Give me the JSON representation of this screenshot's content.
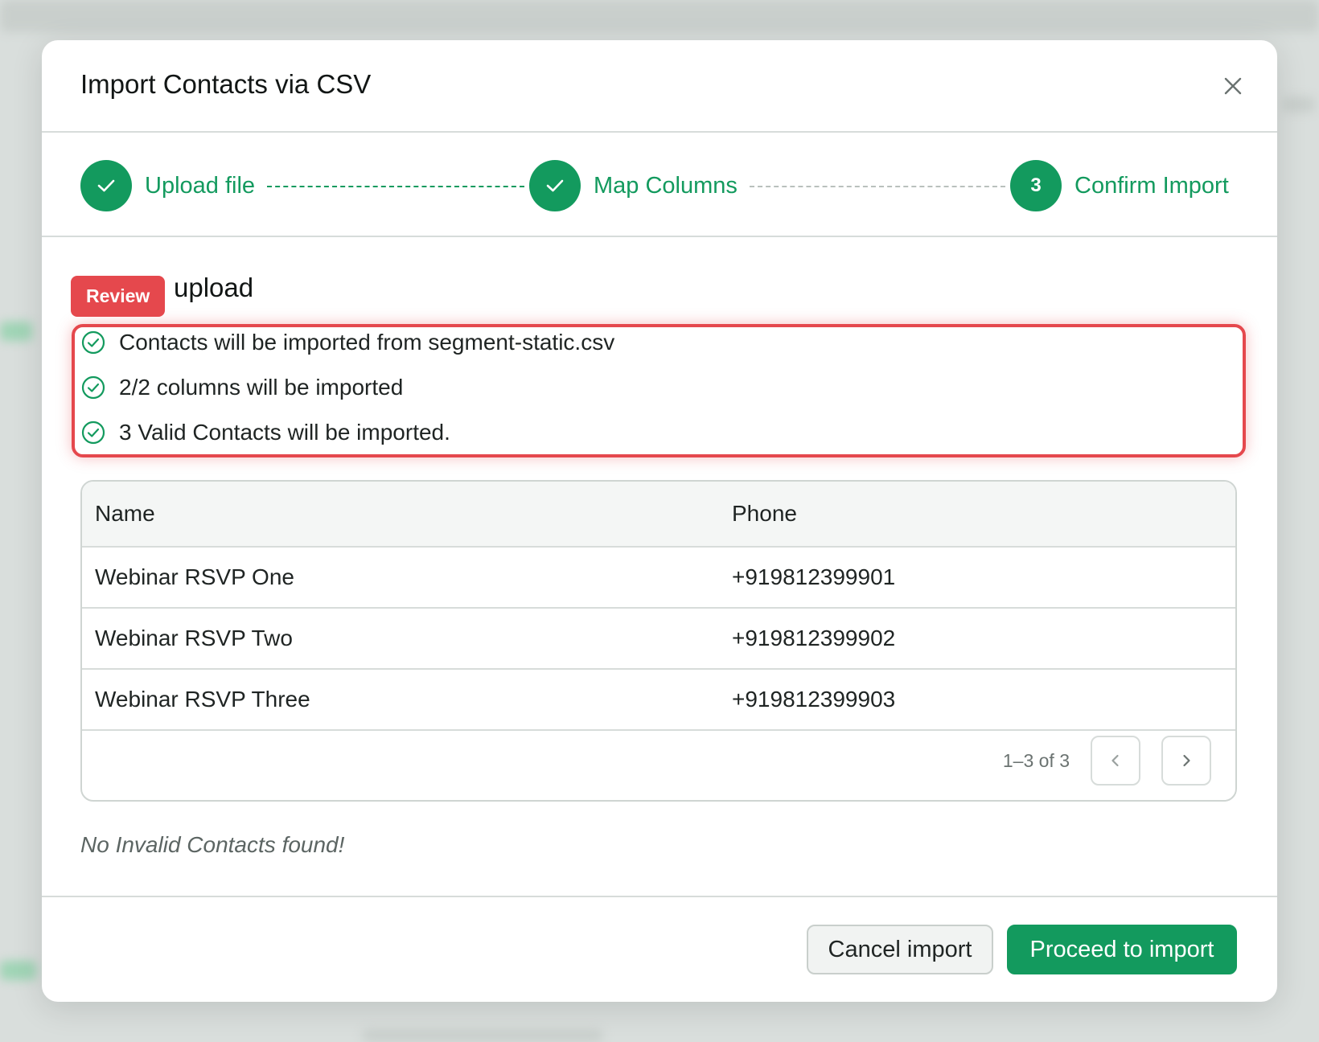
{
  "modal": {
    "title": "Import Contacts via CSV",
    "close_icon": "close-icon"
  },
  "stepper": {
    "steps": [
      {
        "label": "Upload file",
        "status": "complete",
        "marker": "check-icon"
      },
      {
        "label": "Map Columns",
        "status": "complete",
        "marker": "check-icon"
      },
      {
        "label": "Confirm Import",
        "status": "current",
        "marker": "3"
      }
    ]
  },
  "review": {
    "badge": "Review",
    "section_title": "Review upload",
    "section_title_visible": "upload",
    "items": [
      "Contacts will be imported from segment-static.csv",
      "2/2 columns will be imported",
      "3 Valid Contacts will be imported."
    ]
  },
  "table": {
    "columns": [
      "Name",
      "Phone"
    ],
    "rows": [
      {
        "name": "Webinar RSVP One",
        "phone": "+919812399901"
      },
      {
        "name": "Webinar RSVP Two",
        "phone": "+919812399902"
      },
      {
        "name": "Webinar RSVP Three",
        "phone": "+919812399903"
      }
    ],
    "pagination": "1–3 of 3"
  },
  "invalid_note": "No Invalid Contacts found!",
  "footer": {
    "cancel_label": "Cancel import",
    "proceed_label": "Proceed to import"
  },
  "colors": {
    "accent": "#139a5e",
    "review": "#e5484d"
  }
}
